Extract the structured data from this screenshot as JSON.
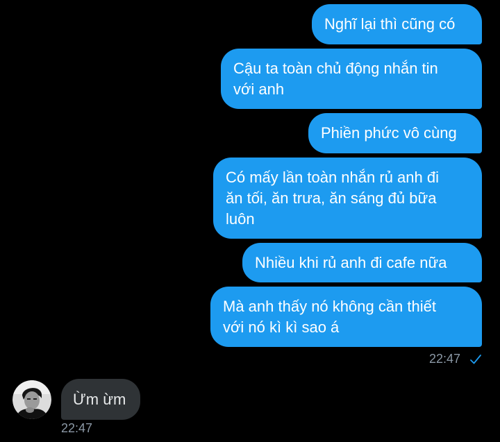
{
  "conversation": {
    "sent_messages": [
      {
        "lines": [
          "Nghĩ lại thì cũng có"
        ]
      },
      {
        "lines": [
          "Cậu ta toàn chủ động nhắn tin",
          "với anh"
        ]
      },
      {
        "lines": [
          "Phiền phức vô cùng"
        ]
      },
      {
        "lines": [
          "Có mấy lần toàn nhắn rủ anh đi",
          "ăn tối, ăn trưa, ăn sáng đủ bữa",
          "luôn"
        ]
      },
      {
        "lines": [
          "Nhiều khi rủ anh đi cafe nữa"
        ]
      },
      {
        "lines": [
          "Mà anh thấy nó không cần thiết",
          "với nó kì kì sao á"
        ]
      }
    ],
    "sent_time": "22:47",
    "received_message": "Ừm ừm",
    "received_time": "22:47"
  },
  "icons": {
    "read_receipt": "check-icon",
    "avatar": "avatar"
  },
  "colors": {
    "background": "#000000",
    "sent_bubble": "#1d9bf0",
    "received_bubble": "#2f3336",
    "timestamp": "#8b98a5",
    "check": "#1d9bf0"
  }
}
